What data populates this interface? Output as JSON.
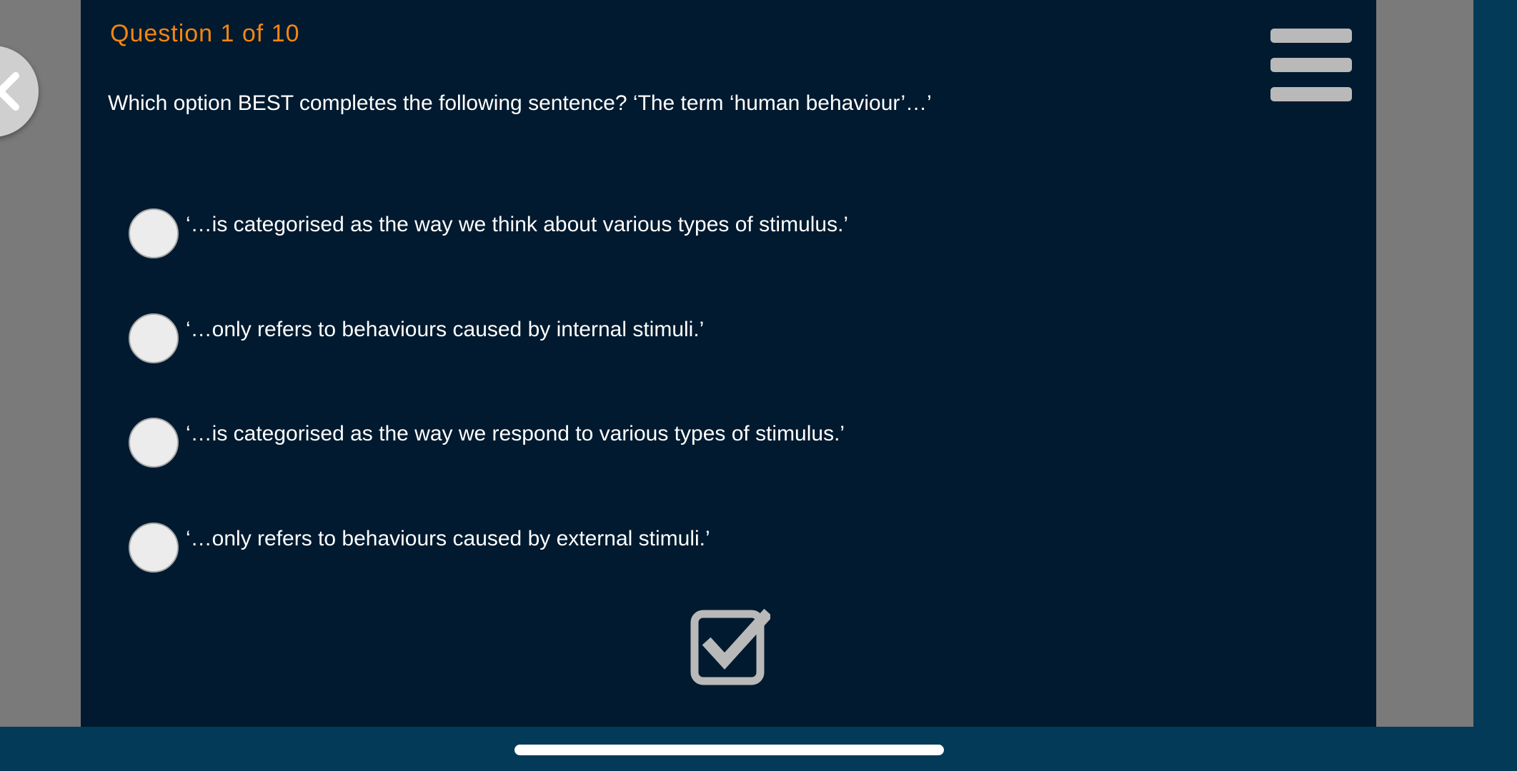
{
  "quiz": {
    "counter": "Question 1 of 10",
    "question": "Which option BEST completes the following sentence? ‘The term ‘human behaviour’…’",
    "options": [
      {
        "label": "‘…is categorised as the way we think about various types of stimulus.’"
      },
      {
        "label": "‘…only refers to behaviours caused by internal stimuli.’"
      },
      {
        "label": "‘…is categorised as the way we respond to various types of stimulus.’"
      },
      {
        "label": "‘…only refers to behaviours caused by external stimuli.’"
      }
    ]
  },
  "icons": {
    "back": "chevron-left-icon",
    "menu": "hamburger-menu-icon",
    "submit": "checkbox-check-icon"
  },
  "colors": {
    "panel_background": "#011a2f",
    "side_gray": "#7a7a7a",
    "outer_navy": "#023a57",
    "counter_orange": "#f5860f",
    "text_white": "#ffffff",
    "icon_gray": "#b9b9b9"
  }
}
